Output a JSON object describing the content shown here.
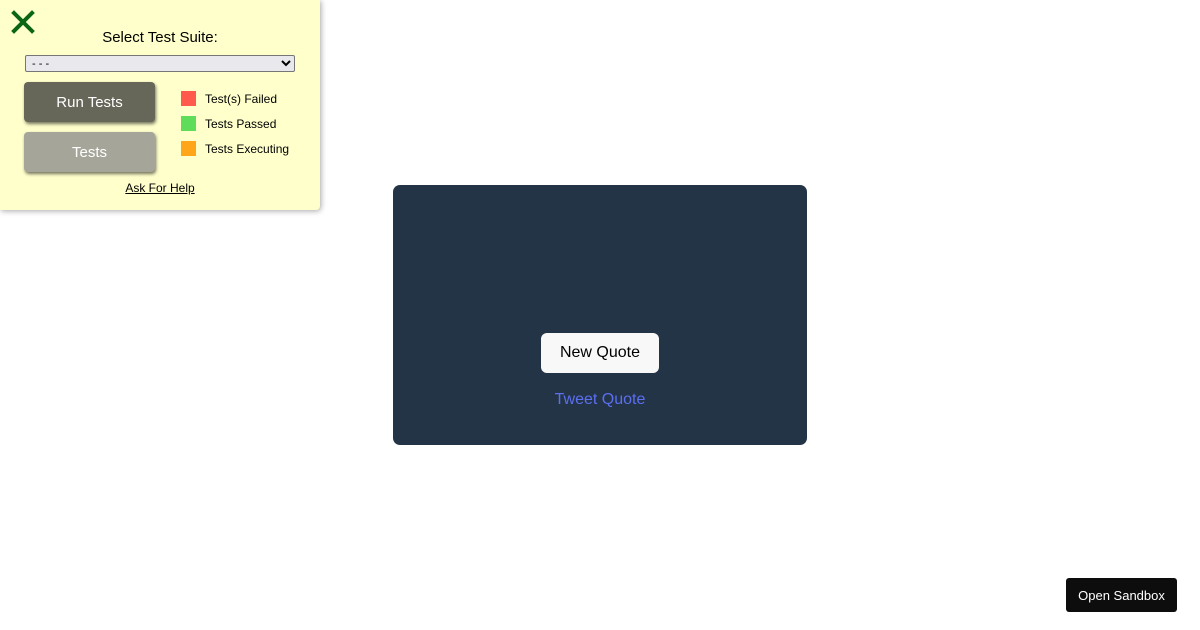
{
  "test_panel": {
    "title": "Select Test Suite:",
    "select_value": "- - -",
    "run_tests_label": "Run Tests",
    "tests_label": "Tests",
    "legend": [
      {
        "label": "Test(s) Failed",
        "color": "#ff5a4b"
      },
      {
        "label": "Tests Passed",
        "color": "#5fdc5a"
      },
      {
        "label": "Tests Executing",
        "color": "#ffa51a"
      }
    ],
    "help_label": "Ask For Help",
    "close_icon": "close-x-icon",
    "close_color": "#0a6614"
  },
  "quote_box": {
    "quote_text": "",
    "author": "",
    "new_quote_label": "New Quote",
    "tweet_label": "Tweet Quote",
    "background": "#233447"
  },
  "sandbox": {
    "label": "Open Sandbox"
  }
}
